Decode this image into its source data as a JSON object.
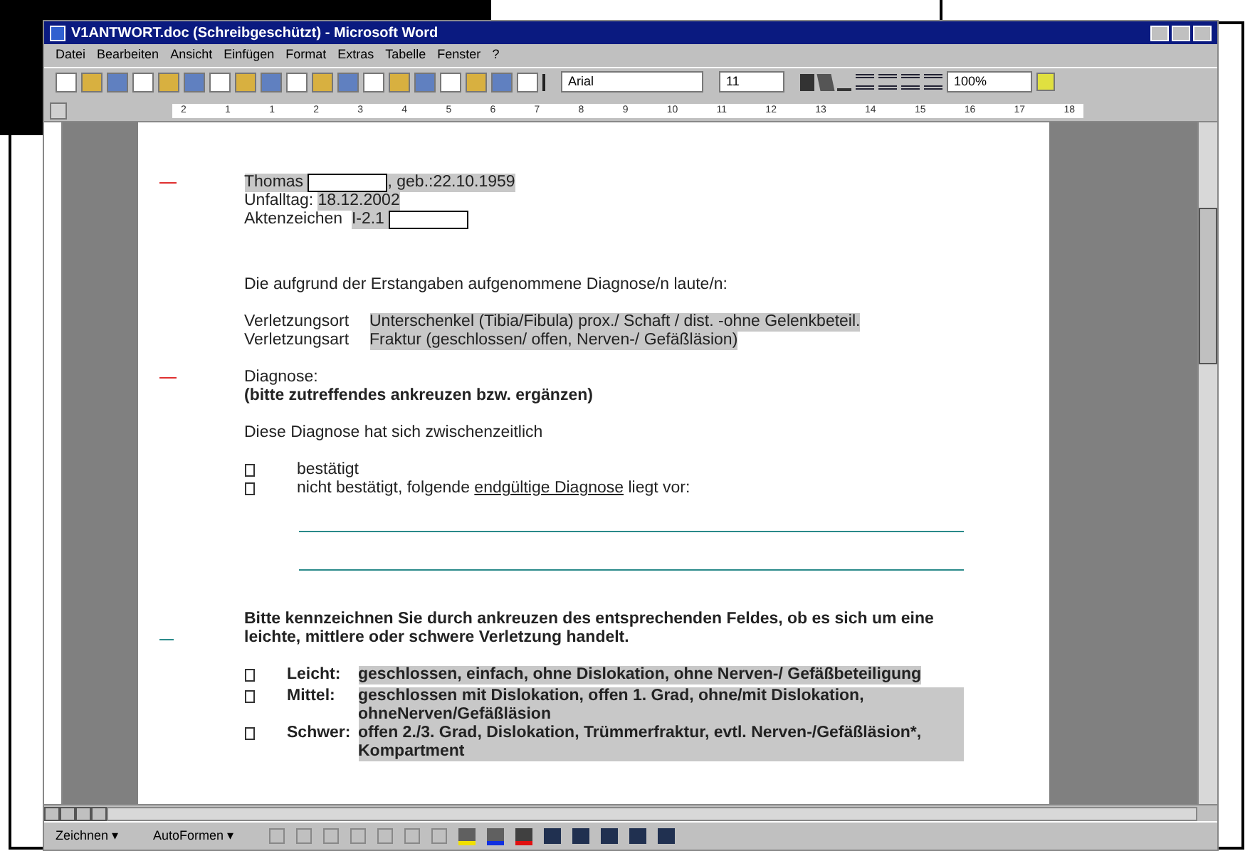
{
  "window": {
    "title": "V1ANTWORT.doc (Schreibgeschützt) - Microsoft Word"
  },
  "menu": [
    "Datei",
    "Bearbeiten",
    "Ansicht",
    "Einfügen",
    "Format",
    "Extras",
    "Tabelle",
    "Fenster",
    "?"
  ],
  "toolbar": {
    "font": "Arial",
    "size": "11",
    "zoom": "100%"
  },
  "ruler": [
    "2",
    "1",
    "1",
    "2",
    "3",
    "4",
    "5",
    "6",
    "7",
    "8",
    "9",
    "10",
    "11",
    "12",
    "13",
    "14",
    "15",
    "16",
    "17",
    "18"
  ],
  "document": {
    "header": [
      [
        {
          "kind": "text",
          "text": "Thomas ",
          "shaded": true
        },
        {
          "kind": "blank"
        },
        {
          "kind": "text",
          "text": ", geb.:22.10.1959",
          "shaded": true
        }
      ],
      [
        {
          "kind": "text",
          "text": "Unfalltag: ",
          "shaded": false
        },
        {
          "kind": "text",
          "text": "18.12.2002",
          "shaded": true
        }
      ],
      [
        {
          "kind": "text",
          "text": "Aktenzeichen  ",
          "shaded": false
        },
        {
          "kind": "text",
          "text": "I-2.1 ",
          "shaded": true
        },
        {
          "kind": "blank"
        }
      ]
    ],
    "intro": "Die aufgrund der Erstangaben aufgenommene Diagnose/n laute/n:",
    "injury": [
      {
        "label": "Verletzungsort",
        "value": "Unterschenkel (Tibia/Fibula) prox./ Schaft / dist. -ohne Gelenkbeteil."
      },
      {
        "label": "Verletzungsart",
        "value": "Fraktur (geschlossen/ offen, Nerven-/ Gefäßläsion)"
      }
    ],
    "diagnosis_title": "Diagnose:",
    "diagnosis_hint": "(bitte zutreffendes ankreuzen bzw. ergänzen)",
    "diagnosis_question": "Diese Diagnose hat sich zwischenzeitlich",
    "diagnosis_options": [
      {
        "checked": false,
        "segments": [
          {
            "text": "bestätigt",
            "underline": false
          }
        ]
      },
      {
        "checked": false,
        "segments": [
          {
            "text": "nicht bestätigt, folgende ",
            "underline": false
          },
          {
            "text": "endgültige Diagnose",
            "underline": true
          },
          {
            "text": " liegt vor:",
            "underline": false
          }
        ]
      }
    ],
    "severity_prompt": "Bitte kennzeichnen Sie durch ankreuzen des entsprechenden Feldes, ob es sich um eine leichte, mittlere oder schwere Verletzung handelt.",
    "severity": [
      {
        "checked": false,
        "label": "Leicht:",
        "text": "geschlossen, einfach, ohne Dislokation, ohne Nerven-/ Gefäßbeteiligung"
      },
      {
        "checked": false,
        "label": "Mittel:",
        "text": "geschlossen mit Dislokation, offen 1. Grad, ohne/mit Dislokation, ohneNerven/Gefäßläsion"
      },
      {
        "checked": false,
        "label": "Schwer:",
        "text": "offen 2./3. Grad, Dislokation, Trümmerfraktur, evtl. Nerven-/Gefäßläsion*, Kompartment"
      }
    ]
  },
  "drawing_toolbar": [
    "Zeichnen ▾",
    "AutoFormen ▾"
  ]
}
